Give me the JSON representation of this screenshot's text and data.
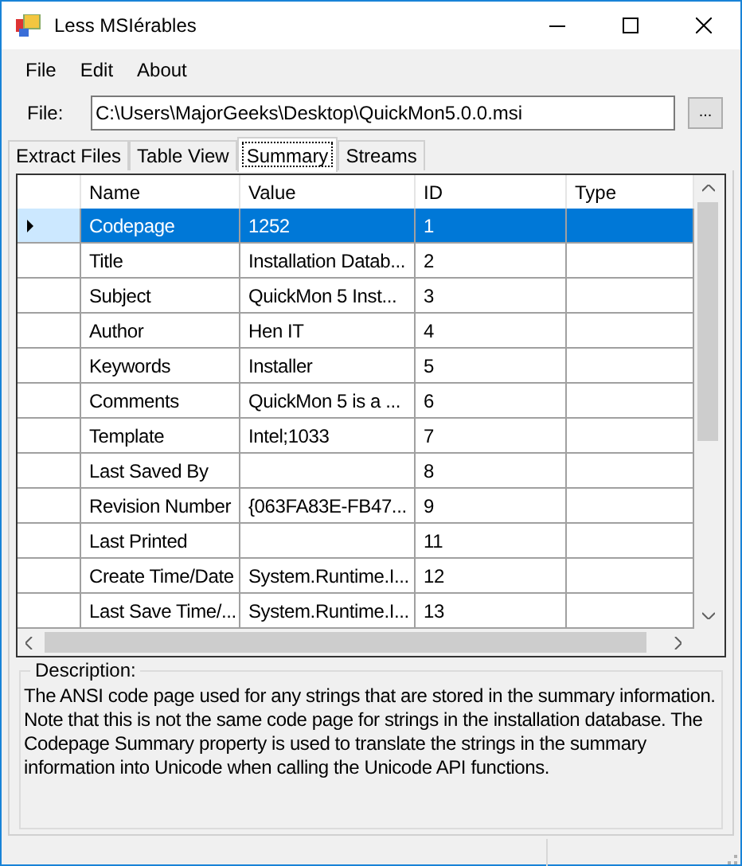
{
  "window": {
    "title": "Less MSIérables"
  },
  "menu": [
    {
      "label": "File"
    },
    {
      "label": "Edit"
    },
    {
      "label": "About"
    }
  ],
  "file_row": {
    "label": "File:",
    "value": "C:\\Users\\MajorGeeks\\Desktop\\QuickMon5.0.0.msi",
    "browse": "..."
  },
  "tabs": [
    {
      "label": "Extract Files",
      "selected": false
    },
    {
      "label": "Table View",
      "selected": false
    },
    {
      "label": "Summary",
      "selected": true
    },
    {
      "label": "Streams",
      "selected": false
    }
  ],
  "table": {
    "columns": [
      "Name",
      "Value",
      "ID",
      "Type"
    ],
    "rows": [
      {
        "cells": [
          "Codepage",
          "1252",
          "1",
          ""
        ],
        "selected": true
      },
      {
        "cells": [
          "Title",
          "Installation Datab...",
          "2",
          ""
        ],
        "selected": false
      },
      {
        "cells": [
          "Subject",
          "QuickMon 5 Inst...",
          "3",
          ""
        ],
        "selected": false
      },
      {
        "cells": [
          "Author",
          "Hen IT",
          "4",
          ""
        ],
        "selected": false
      },
      {
        "cells": [
          "Keywords",
          "Installer",
          "5",
          ""
        ],
        "selected": false
      },
      {
        "cells": [
          "Comments",
          "QuickMon 5 is a ...",
          "6",
          ""
        ],
        "selected": false
      },
      {
        "cells": [
          "Template",
          "Intel;1033",
          "7",
          ""
        ],
        "selected": false
      },
      {
        "cells": [
          "Last Saved By",
          "",
          "8",
          ""
        ],
        "selected": false
      },
      {
        "cells": [
          "Revision Number",
          "{063FA83E-FB47...",
          "9",
          ""
        ],
        "selected": false
      },
      {
        "cells": [
          "Last Printed",
          "",
          "11",
          ""
        ],
        "selected": false
      },
      {
        "cells": [
          "Create Time/Date",
          "System.Runtime.I...",
          "12",
          ""
        ],
        "selected": false
      },
      {
        "cells": [
          "Last Save Time/...",
          "System.Runtime.I...",
          "13",
          ""
        ],
        "selected": false
      }
    ]
  },
  "description": {
    "label": "Description:",
    "text": "The ANSI code page used for any strings that are stored in the summary information. Note that this is not the same code page for strings in the installation database. The Codepage Summary property is used to translate the strings in the summary information into Unicode when calling the Unicode API functions."
  }
}
